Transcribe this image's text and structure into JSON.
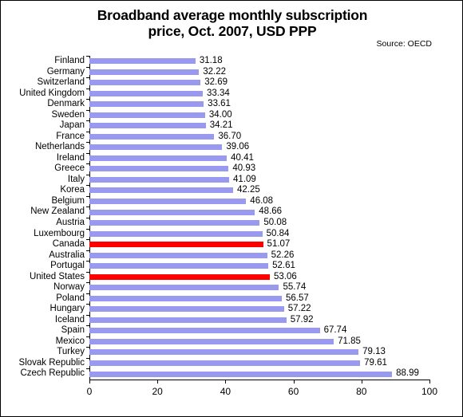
{
  "chart_data": {
    "type": "bar",
    "orientation": "horizontal",
    "title": "Broadband average monthly subscription price, Oct. 2007, USD PPP",
    "title_line1": "Broadband average monthly subscription",
    "title_line2": "price, Oct. 2007, USD PPP",
    "source": "Source: OECD",
    "xlabel": "",
    "ylabel": "",
    "xlim": [
      0,
      100
    ],
    "xticks": [
      0,
      20,
      40,
      60,
      80,
      100
    ],
    "xtick_labels": [
      "0",
      "20",
      "40",
      "60",
      "80",
      "100"
    ],
    "grid": false,
    "legend": "none",
    "bar_color": "#9999F0",
    "highlight_color": "#FF0000",
    "categories": [
      "Finland",
      "Germany",
      "Switzerland",
      "United Kingdom",
      "Denmark",
      "Sweden",
      "Japan",
      "France",
      "Netherlands",
      "Ireland",
      "Greece",
      "Italy",
      "Korea",
      "Belgium",
      "New Zealand",
      "Austria",
      "Luxembourg",
      "Canada",
      "Australia",
      "Portugal",
      "United States",
      "Norway",
      "Poland",
      "Hungary",
      "Iceland",
      "Spain",
      "Mexico",
      "Turkey",
      "Slovak Republic",
      "Czech Republic"
    ],
    "values": [
      31.18,
      32.22,
      32.69,
      33.34,
      33.61,
      34.0,
      34.21,
      36.7,
      39.06,
      40.41,
      40.93,
      41.09,
      42.25,
      46.08,
      48.66,
      50.08,
      50.84,
      51.07,
      52.26,
      52.61,
      53.06,
      55.74,
      56.57,
      57.22,
      57.92,
      67.74,
      71.85,
      79.13,
      79.61,
      88.99
    ],
    "value_labels": [
      "31.18",
      "32.22",
      "32.69",
      "33.34",
      "33.61",
      "34.00",
      "34.21",
      "36.70",
      "39.06",
      "40.41",
      "40.93",
      "41.09",
      "42.25",
      "46.08",
      "48.66",
      "50.08",
      "50.84",
      "51.07",
      "52.26",
      "52.61",
      "53.06",
      "55.74",
      "56.57",
      "57.22",
      "57.92",
      "67.74",
      "71.85",
      "79.13",
      "79.61",
      "88.99"
    ],
    "highlighted": [
      "Canada",
      "United States"
    ]
  }
}
